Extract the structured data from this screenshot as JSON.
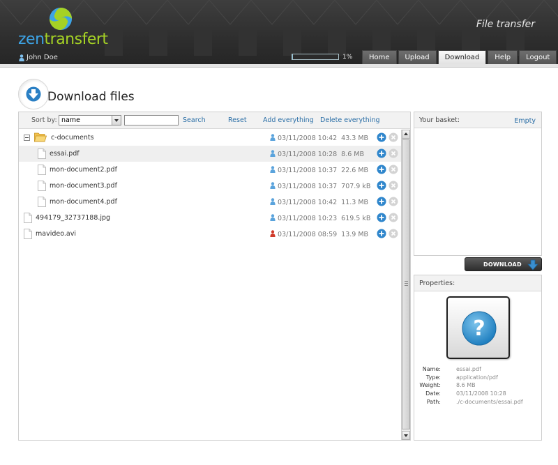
{
  "header": {
    "logo_text_part1": "zen",
    "logo_text_part2": "transfert",
    "caption": "File transfer",
    "user_name": "John Doe",
    "quota_percent": 1,
    "quota_label": "1%",
    "nav": [
      {
        "label": "Home",
        "active": false
      },
      {
        "label": "Upload",
        "active": false
      },
      {
        "label": "Download",
        "active": true
      },
      {
        "label": "Help",
        "active": false
      },
      {
        "label": "Logout",
        "active": false
      }
    ]
  },
  "page": {
    "title": "Download files"
  },
  "toolbar": {
    "sort_label": "Sort by:",
    "sort_value": "name",
    "search_value": "",
    "search_label": "Search",
    "reset_label": "Reset",
    "add_all_label": "Add everything",
    "delete_all_label": "Delete everything"
  },
  "files": [
    {
      "name": "c-documents",
      "type": "folder",
      "level": 0,
      "expanded": true,
      "date": "03/11/2008 10:42",
      "size": "43.3 MB",
      "owner_icon": "user-blue-icon",
      "selected": false
    },
    {
      "name": "essai.pdf",
      "type": "file",
      "level": 1,
      "date": "03/11/2008 10:28",
      "size": "8.6 MB",
      "owner_icon": "user-blue-icon",
      "selected": true
    },
    {
      "name": "mon-document2.pdf",
      "type": "file",
      "level": 1,
      "date": "03/11/2008 10:37",
      "size": "22.6 MB",
      "owner_icon": "user-blue-icon",
      "selected": false
    },
    {
      "name": "mon-document3.pdf",
      "type": "file",
      "level": 1,
      "date": "03/11/2008 10:37",
      "size": "707.9 kB",
      "owner_icon": "user-blue-icon",
      "selected": false
    },
    {
      "name": "mon-document4.pdf",
      "type": "file",
      "level": 1,
      "date": "03/11/2008 10:42",
      "size": "11.3 MB",
      "owner_icon": "user-blue-icon",
      "selected": false
    },
    {
      "name": "494179_32737188.jpg",
      "type": "file",
      "level": 0,
      "date": "03/11/2008 10:23",
      "size": "619.5 kB",
      "owner_icon": "user-blue-icon",
      "selected": false
    },
    {
      "name": "mavideo.avi",
      "type": "file",
      "level": 0,
      "date": "03/11/2008 08:59",
      "size": "13.9 MB",
      "owner_icon": "user-red-icon",
      "selected": false
    }
  ],
  "basket": {
    "title": "Your basket:",
    "empty_label": "Empty"
  },
  "download_button": {
    "label": "DOWNLOAD"
  },
  "properties": {
    "title": "Properties:",
    "preview_icon": "question-mark-icon",
    "fields": [
      {
        "key": "Name:",
        "value": "essai.pdf"
      },
      {
        "key": "Type:",
        "value": "application/pdf"
      },
      {
        "key": "Weight:",
        "value": "8.6 MB"
      },
      {
        "key": "Date:",
        "value": "03/11/2008 10:28"
      },
      {
        "key": "Path:",
        "value": "./c-documents/essai.pdf"
      }
    ]
  },
  "colors": {
    "brand_blue": "#3da3e5",
    "brand_green": "#a5d225",
    "link_blue": "#2a6ea6",
    "action_blue": "#3a8fd0"
  }
}
